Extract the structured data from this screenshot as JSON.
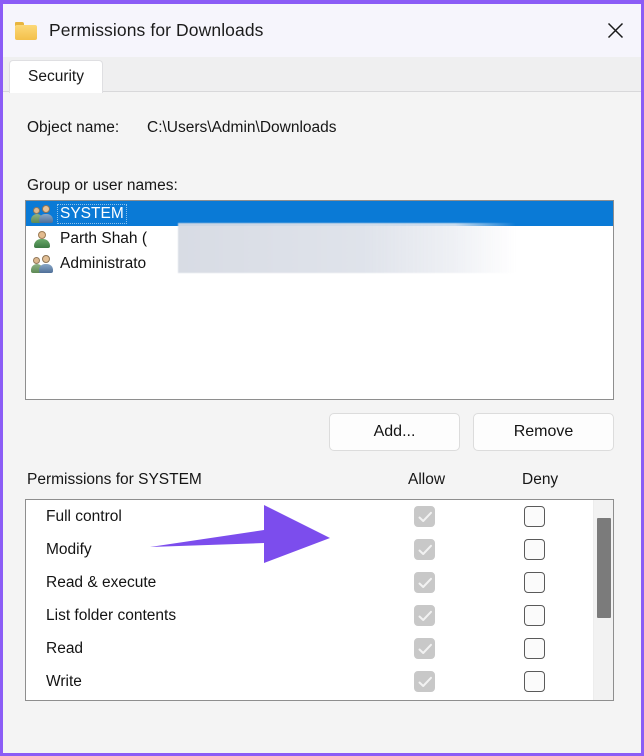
{
  "window": {
    "title": "Permissions for Downloads",
    "folder_icon": "folder-icon",
    "close_icon": "close-icon",
    "border_color": "#8b5cf6"
  },
  "tabs": [
    {
      "label": "Security",
      "active": true
    }
  ],
  "object": {
    "label": "Object name:",
    "value": "C:\\Users\\Admin\\Downloads"
  },
  "group_section": {
    "label": "Group or user names:",
    "items": [
      {
        "name": "SYSTEM",
        "icon": "group-users-icon",
        "selected": true,
        "redacted": false
      },
      {
        "name": "Parth Shah (",
        "icon": "single-user-icon",
        "selected": false,
        "redacted": true
      },
      {
        "name": "Administrato",
        "icon": "group-users-icon",
        "selected": false,
        "redacted": true
      }
    ],
    "selected_highlight_color": "#0a7ad6"
  },
  "buttons": {
    "add": "Add...",
    "remove": "Remove"
  },
  "permissions_section": {
    "title": "Permissions for SYSTEM",
    "columns": [
      "Allow",
      "Deny"
    ],
    "rows": [
      {
        "name": "Full control",
        "allow": true,
        "allow_disabled": true,
        "deny": false
      },
      {
        "name": "Modify",
        "allow": true,
        "allow_disabled": true,
        "deny": false
      },
      {
        "name": "Read & execute",
        "allow": true,
        "allow_disabled": true,
        "deny": false
      },
      {
        "name": "List folder contents",
        "allow": true,
        "allow_disabled": true,
        "deny": false
      },
      {
        "name": "Read",
        "allow": true,
        "allow_disabled": true,
        "deny": false
      },
      {
        "name": "Write",
        "allow": true,
        "allow_disabled": true,
        "deny": false
      }
    ],
    "scrollbar": {
      "visible": true
    }
  },
  "annotation": {
    "arrow": {
      "color": "#7c4ded",
      "points_to": "Add...",
      "direction": "right"
    }
  }
}
